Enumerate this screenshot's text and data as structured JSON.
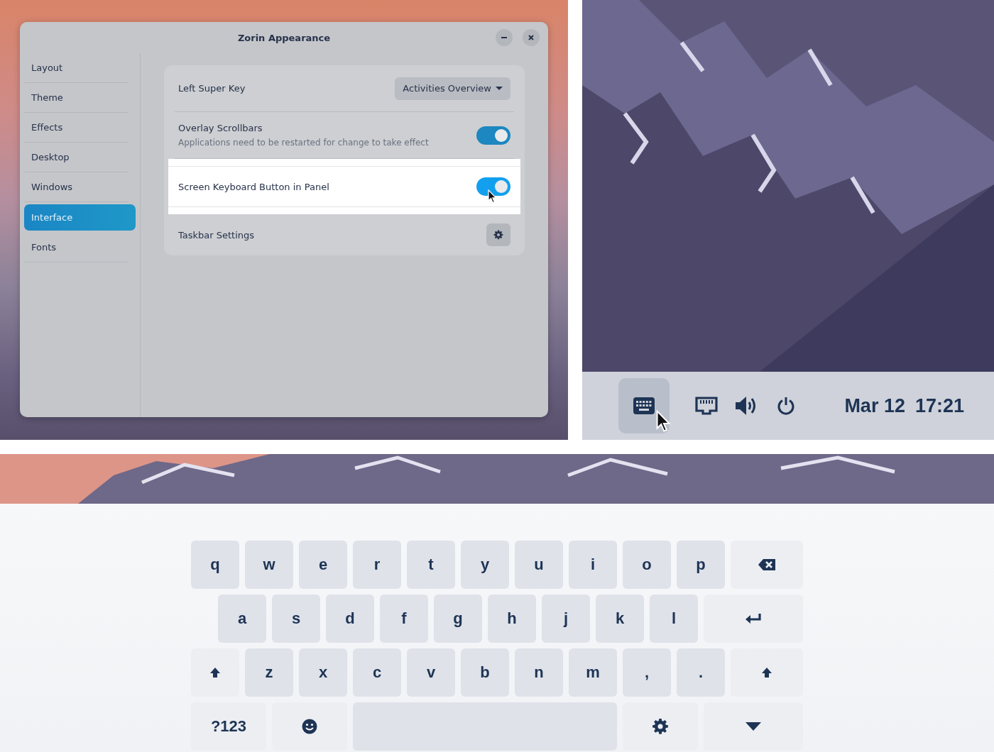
{
  "window": {
    "title": "Zorin Appearance"
  },
  "sidebar": {
    "items": [
      {
        "label": "Layout",
        "selected": false
      },
      {
        "label": "Theme",
        "selected": false
      },
      {
        "label": "Effects",
        "selected": false
      },
      {
        "label": "Desktop",
        "selected": false
      },
      {
        "label": "Windows",
        "selected": false
      },
      {
        "label": "Interface",
        "selected": true
      },
      {
        "label": "Fonts",
        "selected": false
      }
    ]
  },
  "settings": [
    {
      "kind": "dropdown",
      "label": "Left Super Key",
      "value": "Activities Overview",
      "highlighted": false
    },
    {
      "kind": "toggle",
      "label": "Overlay Scrollbars",
      "description": "Applications need to be restarted for change to take effect",
      "on": true,
      "highlighted": false
    },
    {
      "kind": "toggle",
      "label": "Screen Keyboard Button in Panel",
      "on": true,
      "highlighted": true
    },
    {
      "kind": "button",
      "label": "Taskbar Settings",
      "highlighted": false
    }
  ],
  "panel": {
    "indicators": [
      {
        "kind": "keyboard",
        "selected": true
      },
      {
        "kind": "network",
        "selected": false
      },
      {
        "kind": "volume",
        "selected": false
      },
      {
        "kind": "power",
        "selected": false
      }
    ],
    "date": "Mar 12",
    "time": "17:21"
  },
  "keyboard": {
    "rows": [
      [
        {
          "kind": "char",
          "label": "q"
        },
        {
          "kind": "char",
          "label": "w"
        },
        {
          "kind": "char",
          "label": "e"
        },
        {
          "kind": "char",
          "label": "r"
        },
        {
          "kind": "char",
          "label": "t"
        },
        {
          "kind": "char",
          "label": "y"
        },
        {
          "kind": "char",
          "label": "u"
        },
        {
          "kind": "char",
          "label": "i"
        },
        {
          "kind": "char",
          "label": "o"
        },
        {
          "kind": "char",
          "label": "p"
        },
        {
          "kind": "backspace"
        }
      ],
      [
        {
          "kind": "char",
          "label": "a"
        },
        {
          "kind": "char",
          "label": "s"
        },
        {
          "kind": "char",
          "label": "d"
        },
        {
          "kind": "char",
          "label": "f"
        },
        {
          "kind": "char",
          "label": "g"
        },
        {
          "kind": "char",
          "label": "h"
        },
        {
          "kind": "char",
          "label": "j"
        },
        {
          "kind": "char",
          "label": "k"
        },
        {
          "kind": "char",
          "label": "l"
        },
        {
          "kind": "enter"
        }
      ],
      [
        {
          "kind": "shift"
        },
        {
          "kind": "char",
          "label": "z"
        },
        {
          "kind": "char",
          "label": "x"
        },
        {
          "kind": "char",
          "label": "c"
        },
        {
          "kind": "char",
          "label": "v"
        },
        {
          "kind": "char",
          "label": "b"
        },
        {
          "kind": "char",
          "label": "n"
        },
        {
          "kind": "char",
          "label": "m"
        },
        {
          "kind": "char",
          "label": ","
        },
        {
          "kind": "char",
          "label": "."
        },
        {
          "kind": "shift"
        }
      ],
      [
        {
          "kind": "mode",
          "label": "?123"
        },
        {
          "kind": "emoji"
        },
        {
          "kind": "space"
        },
        {
          "kind": "settings"
        },
        {
          "kind": "hide"
        }
      ]
    ]
  }
}
